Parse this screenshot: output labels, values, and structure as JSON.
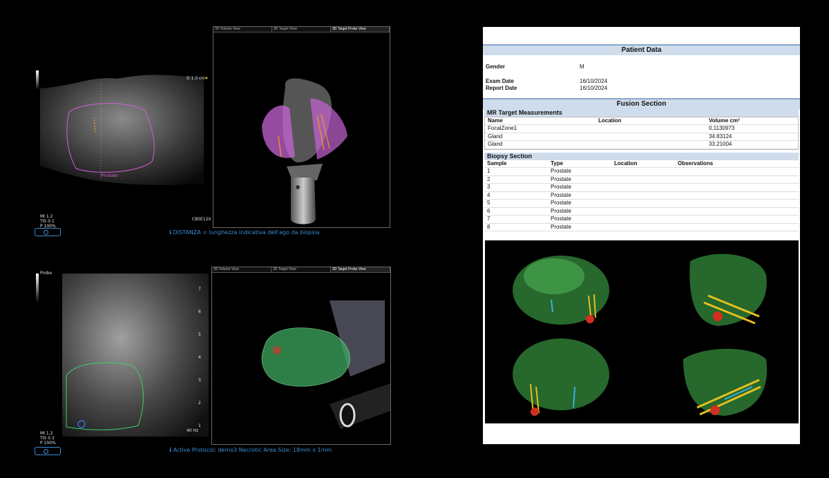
{
  "top_left": {
    "depth": "D 1.3 cm",
    "prostate_label": "Prostate",
    "mi": "MI 1.2",
    "tis": "TIS 0.1",
    "power": "P 100%",
    "probe": "CBSE12X",
    "tabs": [
      "3D Volume View",
      "3D Target View",
      "3D Target Probe View"
    ],
    "caption": "ℹ DISTANZA = lunghezza indicativa dell'ago da biopsia"
  },
  "bottom_left": {
    "probe_label": "Probe",
    "frequency": "40 Hz",
    "mi": "MI 1.2",
    "tis": "TIS 0.3",
    "power": "P 100%",
    "scale": [
      "7",
      "6",
      "5",
      "4",
      "3",
      "2",
      "1"
    ],
    "tabs": [
      "3D Volume View",
      "3D Target View",
      "3D Target Probe View"
    ],
    "caption": "ℹ Active Protocol: demo3    Necrotic Area Size: 18mm x 1mm"
  },
  "report": {
    "patient_title": "Patient Data",
    "gender_label": "Gender",
    "gender_value": "M",
    "exam_label": "Exam Date",
    "exam_value": "16/10/2024",
    "report_label": "Report Date",
    "report_value": "16/10/2024",
    "fusion_title": "Fusion Section",
    "mr_title": "MR Target Measurements",
    "mr_headers": [
      "Name",
      "Location",
      "Volume  cm³"
    ],
    "mr_rows": [
      [
        "FocalZone1",
        "",
        "0.1130973"
      ],
      [
        "Gland",
        "",
        "34.83124"
      ],
      [
        "Gland",
        "",
        "33.21004"
      ]
    ],
    "biopsy_title": "Biopsy Section",
    "biopsy_headers": [
      "Sample",
      "Type",
      "Location",
      "Observations"
    ],
    "biopsy_rows": [
      [
        "1",
        "Prostate"
      ],
      [
        "2",
        "Prostate"
      ],
      [
        "3",
        "Prostate"
      ],
      [
        "4",
        "Prostate"
      ],
      [
        "5",
        "Prostate"
      ],
      [
        "6",
        "Prostate"
      ],
      [
        "7",
        "Prostate"
      ],
      [
        "8",
        "Prostate"
      ]
    ]
  }
}
